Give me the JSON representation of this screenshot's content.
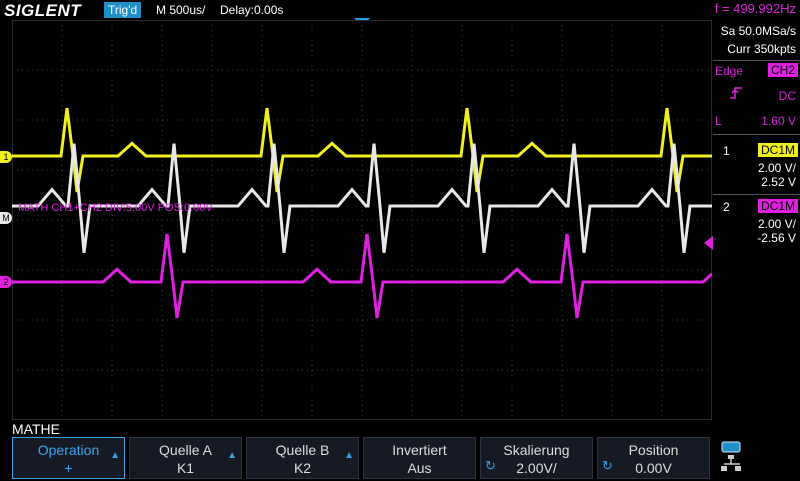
{
  "header": {
    "logo": "SIGLENT",
    "trigger_status": "Trig'd",
    "timebase": "M 500us/",
    "delay": "Delay:0.00s",
    "frequency": "f = 499.992Hz"
  },
  "acquisition": {
    "sample_rate": "Sa 50.0MSa/s",
    "memory": "Curr 350kpts"
  },
  "trigger": {
    "type": "Edge",
    "source": "CH2",
    "coupling": "DC",
    "level_label": "L",
    "level": "1.60 V"
  },
  "channels": [
    {
      "num": "1",
      "coupling": "DC1M",
      "scale": "2.00 V/",
      "offset": "2.52 V",
      "color": "#f0f020"
    },
    {
      "num": "2",
      "coupling": "DC1M",
      "scale": "2.00 V/",
      "offset": "-2.56 V",
      "color": "#e020e0"
    }
  ],
  "markers": {
    "ch1": "1",
    "math": "M",
    "ch2": "2"
  },
  "math_info": "MATH  CH1+CH2  DIV:5.00V  POS:0.00V",
  "menu": {
    "title": "MATHE",
    "softkeys": [
      {
        "line1": "Operation",
        "line2": "+",
        "selected": true
      },
      {
        "line1": "Quelle A",
        "line2": "K1"
      },
      {
        "line1": "Quelle B",
        "line2": "K2"
      },
      {
        "line1": "Invertiert",
        "line2": "Aus"
      },
      {
        "line1": "Skalierung",
        "line2": "2.00V/"
      },
      {
        "line1": "Position",
        "line2": "0.00V"
      }
    ]
  },
  "colors": {
    "ch1": "#f0f020",
    "ch2": "#e020e0",
    "math": "#e8e8e8",
    "accent": "#1e8fc8"
  }
}
